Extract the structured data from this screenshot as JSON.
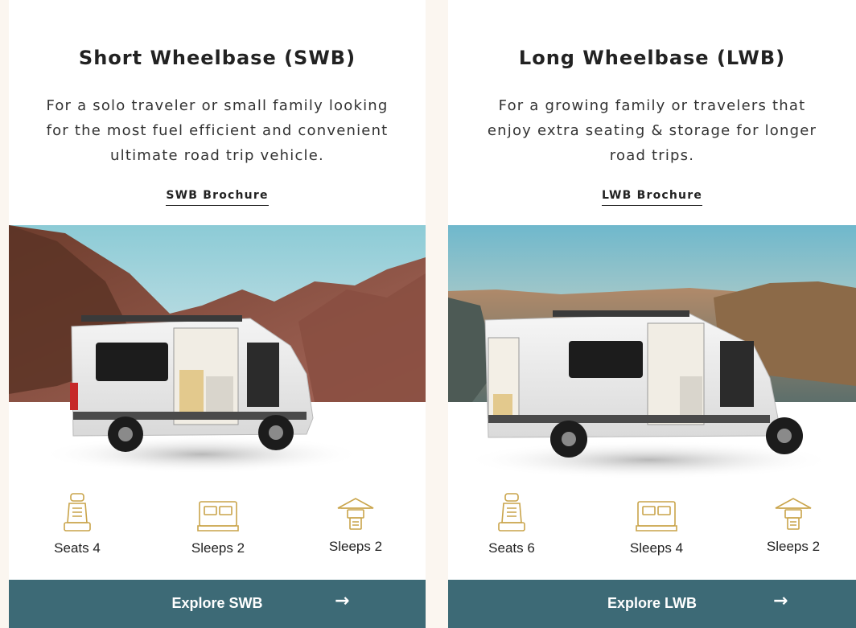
{
  "colors": {
    "cta_bg": "#3d6a76",
    "icon_gold": "#c9a44a",
    "strip_bg": "#fbf6f0"
  },
  "cards": [
    {
      "id": "swb",
      "title": "Short Wheelbase (SWB)",
      "description": "For a solo traveler or small family looking for the most fuel efficient and convenient ultimate road trip vehicle.",
      "brochure_link": "SWB Brochure",
      "image_alt": "White short wheelbase camper van with side door open in front of red rock desert",
      "features": [
        {
          "icon": "seat-icon",
          "label": "Seats 4"
        },
        {
          "icon": "bed-icon",
          "label": "Sleeps 2"
        },
        {
          "icon": "rooftop-tent-icon",
          "label": "Sleeps 2"
        }
      ],
      "cta_label": "Explore SWB",
      "cta_arrow": "→"
    },
    {
      "id": "lwb",
      "title": "Long Wheelbase (LWB)",
      "description": "For a growing family or travelers that enjoy extra seating & storage for longer road trips.",
      "brochure_link": "LWB Brochure",
      "image_alt": "White long wheelbase camper van with doors open in front of a canyon landscape",
      "features": [
        {
          "icon": "seat-icon",
          "label": "Seats 6"
        },
        {
          "icon": "bed-icon",
          "label": "Sleeps 4"
        },
        {
          "icon": "rooftop-tent-icon",
          "label": "Sleeps 2"
        }
      ],
      "cta_label": "Explore LWB",
      "cta_arrow": "→"
    }
  ]
}
